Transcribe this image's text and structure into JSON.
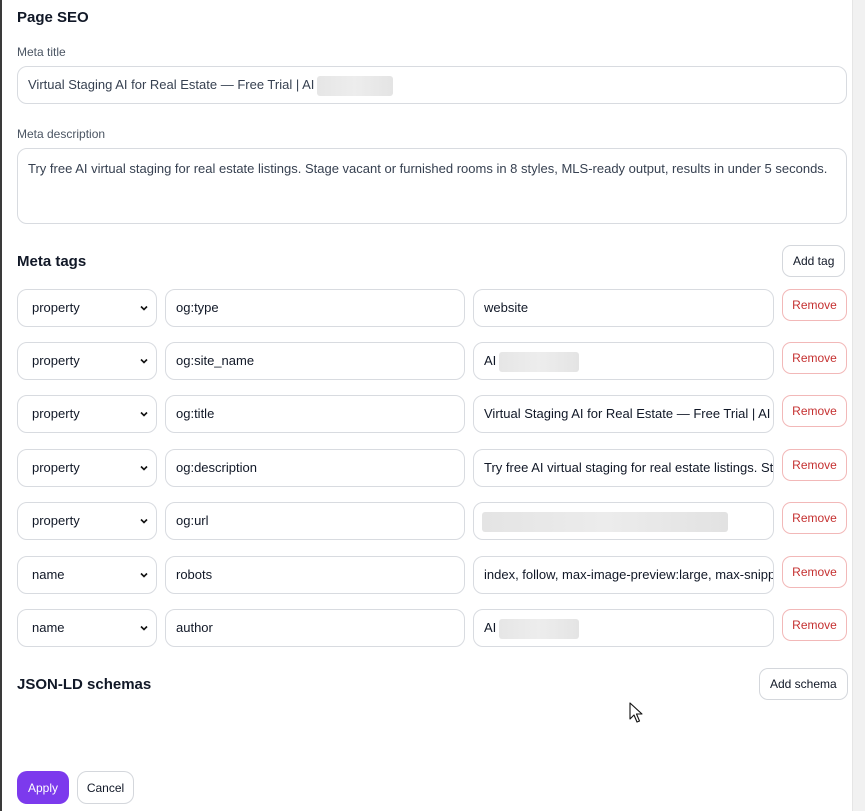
{
  "page_seo": {
    "title": "Page SEO",
    "meta_title_label": "Meta title",
    "meta_title_value": "Virtual Staging AI for Real Estate — Free Trial | AI",
    "meta_description_label": "Meta description",
    "meta_description_value": "Try free AI virtual staging for real estate listings. Stage vacant or furnished rooms in 8 styles, MLS-ready output, results in under 5 seconds."
  },
  "meta_tags": {
    "title": "Meta tags",
    "add_label": "Add tag",
    "remove_label": "Remove",
    "rows": [
      {
        "attr": "property",
        "key": "og:type",
        "value": "website"
      },
      {
        "attr": "property",
        "key": "og:site_name",
        "value": "AI"
      },
      {
        "attr": "property",
        "key": "og:title",
        "value": "Virtual Staging AI for Real Estate — Free Trial | AI"
      },
      {
        "attr": "property",
        "key": "og:description",
        "value": "Try free AI virtual staging for real estate listings. Stage"
      },
      {
        "attr": "property",
        "key": "og:url",
        "value": ""
      },
      {
        "attr": "name",
        "key": "robots",
        "value": "index, follow, max-image-preview:large, max-snippet"
      },
      {
        "attr": "name",
        "key": "author",
        "value": "AI"
      }
    ]
  },
  "json_ld": {
    "title": "JSON-LD schemas",
    "add_label": "Add schema"
  },
  "footer": {
    "apply_label": "Apply",
    "cancel_label": "Cancel"
  },
  "colors": {
    "accent": "#7c3aed",
    "danger": "#c53030"
  }
}
